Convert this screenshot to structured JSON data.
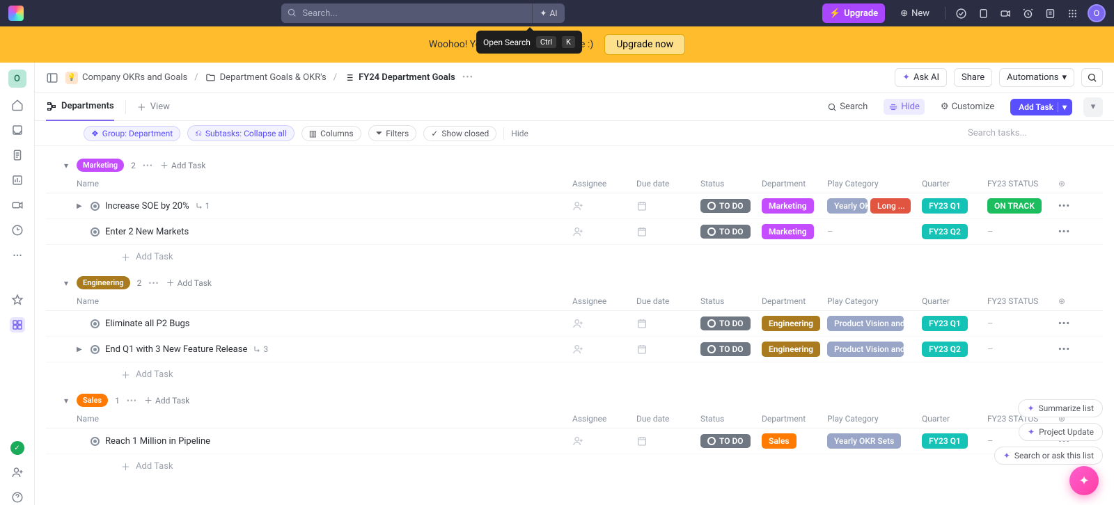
{
  "topbar": {
    "search_placeholder": "Search...",
    "ai_label": "AI",
    "upgrade": "Upgrade",
    "new": "New",
    "avatar": "O"
  },
  "banner": {
    "text_left": "Woohoo! You're over your",
    "text_right": "upgrade :)",
    "button": "Upgrade now"
  },
  "tooltip": {
    "label": "Open Search",
    "key1": "Ctrl",
    "key2": "K"
  },
  "workspace": {
    "letter": "O"
  },
  "breadcrumb": {
    "a": "Company OKRs and Goals",
    "b": "Department Goals & OKR's",
    "c": "FY24 Department Goals"
  },
  "header_actions": {
    "ask_ai": "Ask AI",
    "share": "Share",
    "automations": "Automations"
  },
  "viewbar": {
    "tab": "Departments",
    "add_view": "View",
    "search": "Search",
    "hide": "Hide",
    "customize": "Customize",
    "add_task": "Add Task"
  },
  "filters": {
    "group": "Group: Department",
    "subtasks": "Subtasks: Collapse all",
    "columns": "Columns",
    "filters": "Filters",
    "show_closed": "Show closed",
    "hide": "Hide",
    "search_placeholder": "Search tasks..."
  },
  "columns": {
    "name": "Name",
    "assignee": "Assignee",
    "due": "Due date",
    "status": "Status",
    "dept": "Department",
    "play": "Play Category",
    "quarter": "Quarter",
    "fy23": "FY23 STATUS"
  },
  "labels": {
    "todo": "TO DO",
    "add_task": "Add Task",
    "dash": "–"
  },
  "colors": {
    "marketing": "#c44eff",
    "engineering": "#a97a1e",
    "sales": "#ff7a00",
    "teal": "#15c3b6",
    "track": "#1bbd5e",
    "play_light": "#9aa6c8",
    "play_red": "#e1543f"
  },
  "groups": [
    {
      "name": "Marketing",
      "count": "2",
      "color": "#c44eff",
      "tasks": [
        {
          "name": "Increase SOE by 20%",
          "sub": "1",
          "expand": true,
          "dept": "Marketing",
          "play": [
            "Yearly OK...",
            "Long ..."
          ],
          "play_colors": [
            "light",
            "red"
          ],
          "quarter": "FY23 Q1",
          "fy": "ON TRACK"
        },
        {
          "name": "Enter 2 New Markets",
          "dept": "Marketing",
          "quarter": "FY23 Q2"
        }
      ]
    },
    {
      "name": "Engineering",
      "count": "2",
      "color": "#a97a1e",
      "tasks": [
        {
          "name": "Eliminate all P2 Bugs",
          "dept": "Engineering",
          "play": [
            "Product Vision and ..."
          ],
          "play_colors": [
            "light"
          ],
          "quarter": "FY23 Q1"
        },
        {
          "name": "End Q1 with 3 New Feature Release",
          "sub": "3",
          "expand": true,
          "dept": "Engineering",
          "play": [
            "Product Vision and ..."
          ],
          "play_colors": [
            "light"
          ],
          "quarter": "FY23 Q2"
        }
      ]
    },
    {
      "name": "Sales",
      "count": "1",
      "color": "#ff7a00",
      "tasks": [
        {
          "name": "Reach 1 Million in Pipeline",
          "dept": "Sales",
          "play": [
            "Yearly OKR Sets"
          ],
          "play_colors": [
            "light"
          ],
          "quarter": "FY23 Q1"
        }
      ]
    }
  ],
  "floaters": {
    "summarize": "Summarize list",
    "project": "Project Update",
    "search": "Search or ask this list"
  }
}
